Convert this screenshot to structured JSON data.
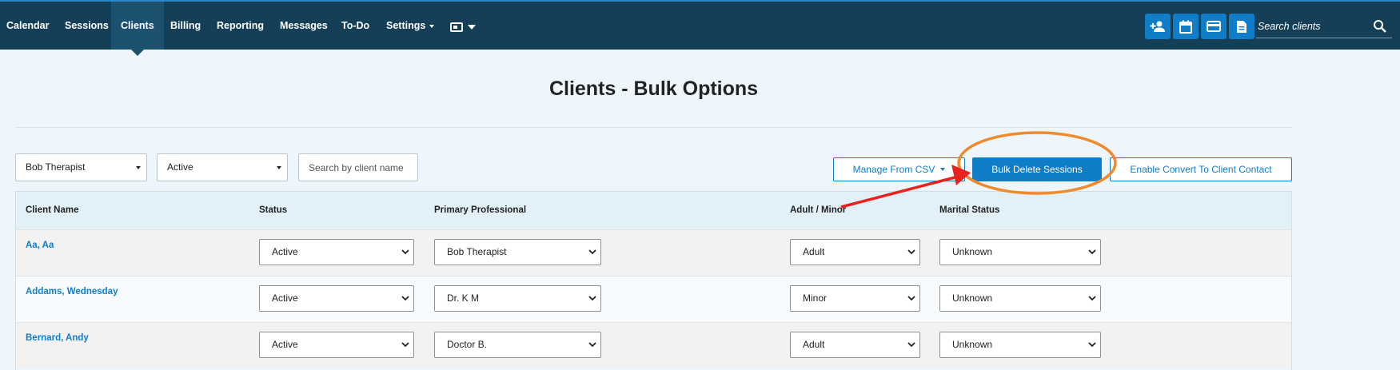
{
  "nav": {
    "items": [
      {
        "label": "Calendar"
      },
      {
        "label": "Sessions"
      },
      {
        "label": "Clients"
      },
      {
        "label": "Billing"
      },
      {
        "label": "Reporting"
      },
      {
        "label": "Messages"
      },
      {
        "label": "To-Do"
      },
      {
        "label": "Settings"
      }
    ],
    "active": "Clients",
    "search_placeholder": "Search clients",
    "quick_actions": [
      "add-client-icon",
      "calendar-icon",
      "credit-card-icon",
      "document-icon"
    ]
  },
  "page": {
    "title": "Clients - Bulk Options"
  },
  "filters": {
    "professional": "Bob Therapist",
    "status": "Active",
    "search_placeholder": "Search by client name"
  },
  "actions": {
    "manage_csv": "Manage From CSV",
    "bulk_delete": "Bulk Delete Sessions",
    "enable_convert": "Enable Convert To Client Contact"
  },
  "table": {
    "headers": {
      "client_name": "Client Name",
      "status": "Status",
      "primary_professional": "Primary Professional",
      "adult_minor": "Adult / Minor",
      "marital_status": "Marital Status"
    },
    "rows": [
      {
        "name": "Aa, Aa",
        "status": "Active",
        "professional": "Bob Therapist",
        "adult_minor": "Adult",
        "marital": "Unknown"
      },
      {
        "name": "Addams, Wednesday",
        "status": "Active",
        "professional": "Dr. K M",
        "adult_minor": "Minor",
        "marital": "Unknown"
      },
      {
        "name": "Bernard, Andy",
        "status": "Active",
        "professional": "Doctor B.",
        "adult_minor": "Adult",
        "marital": "Unknown"
      }
    ]
  },
  "colors": {
    "nav_bg": "#143f57",
    "accent": "#0f7dc8",
    "highlight_circle": "#f08a2c",
    "arrow": "#e8231f"
  }
}
